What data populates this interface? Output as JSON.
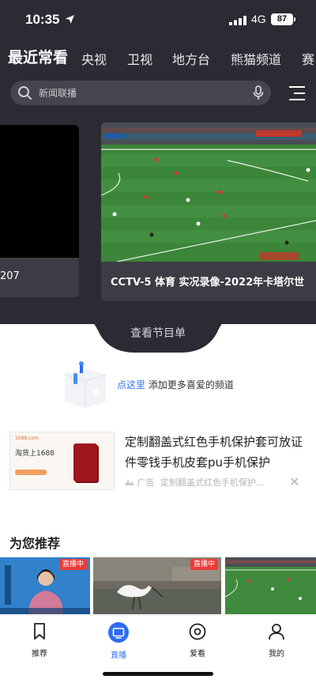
{
  "status_bar": {
    "time": "10:35",
    "network": "4G",
    "battery": "87"
  },
  "tabs": [
    "最近常看",
    "央视",
    "卫视",
    "地方台",
    "熊猫频道",
    "赛"
  ],
  "search": {
    "placeholder": "新闻联播"
  },
  "channels": {
    "left_caption": "207",
    "main_caption": "CCTV-5 体育 实况录像-2022年卡塔尔世"
  },
  "schedule_link": "查看节目单",
  "empty_state": {
    "link": "点这里",
    "text": "添加更多喜爱的频道"
  },
  "ad": {
    "thumb_site": "1688.com",
    "thumb_text": "淘货上1688",
    "title": "定制翻盖式红色手机保护套可放证件零钱手机皮套pu手机保护",
    "tag": "广告",
    "subtitle": "定制翻盖式红色手机保护...",
    "close": "✕"
  },
  "recommend": {
    "title": "为您推荐",
    "items": [
      {
        "badge": "直播中"
      },
      {
        "badge": "直播中"
      },
      {
        "badge": ""
      }
    ]
  },
  "tabbar": [
    {
      "label": "推荐",
      "icon": "bookmark-icon"
    },
    {
      "label": "直播",
      "icon": "tv-icon"
    },
    {
      "label": "爱看",
      "icon": "target-icon"
    },
    {
      "label": "我的",
      "icon": "person-icon"
    }
  ],
  "colors": {
    "dark_bg": "#2b2c33",
    "accent": "#2f6cf3",
    "live_badge": "#ea3b3b",
    "link": "#3477f0"
  }
}
